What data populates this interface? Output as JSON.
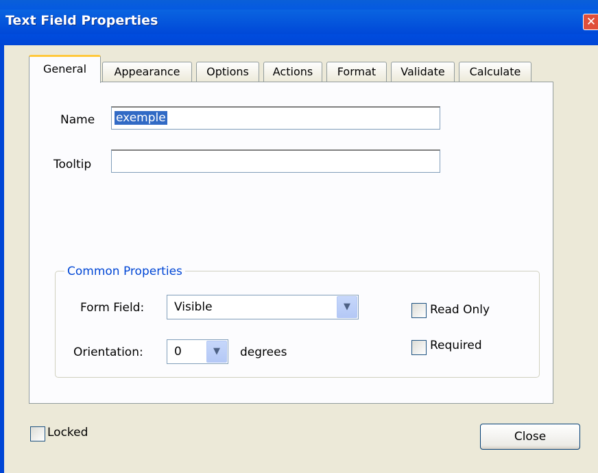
{
  "window": {
    "title": "Text Field Properties"
  },
  "tabs": [
    {
      "label": "General"
    },
    {
      "label": "Appearance"
    },
    {
      "label": "Options"
    },
    {
      "label": "Actions"
    },
    {
      "label": "Format"
    },
    {
      "label": "Validate"
    },
    {
      "label": "Calculate"
    }
  ],
  "general": {
    "name_label": "Name",
    "name_value": "exemple",
    "tooltip_label": "Tooltip",
    "tooltip_value": ""
  },
  "common": {
    "legend": "Common Properties",
    "form_field_label": "Form Field:",
    "form_field_value": "Visible",
    "orientation_label": "Orientation:",
    "orientation_value": "0",
    "degrees_label": "degrees",
    "read_only_label": "Read Only",
    "required_label": "Required"
  },
  "footer": {
    "locked_label": "Locked",
    "close_label": "Close"
  },
  "colors": {
    "titlebar": "#0055ea",
    "accent": "#0046d5",
    "active_tab_highlight": "#ffc83c",
    "selection": "#316ac5"
  }
}
